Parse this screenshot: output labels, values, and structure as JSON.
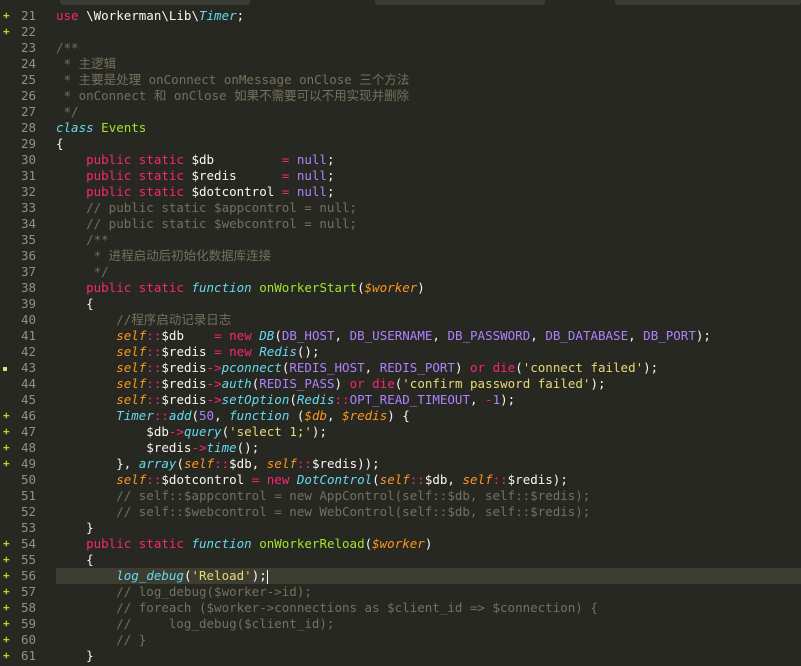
{
  "colors": {
    "background": "#272822",
    "gutter_text": "#90908a",
    "current_line": "#3e3d32",
    "diff_added": "#a6e22e",
    "diff_modified": "#e6db74"
  },
  "editor": {
    "current_line": 56,
    "lines": [
      {
        "n": "21",
        "mark": "add",
        "tokens": [
          [
            "kw",
            "use"
          ],
          [
            "pl",
            " \\Workerman\\Lib\\"
          ],
          [
            "cls",
            "Timer"
          ],
          [
            "pl",
            ";"
          ]
        ]
      },
      {
        "n": "22",
        "mark": "add",
        "tokens": []
      },
      {
        "n": "23",
        "mark": "",
        "tokens": [
          [
            "cm",
            "/**"
          ]
        ]
      },
      {
        "n": "24",
        "mark": "",
        "tokens": [
          [
            "cm",
            " * 主逻辑"
          ]
        ]
      },
      {
        "n": "25",
        "mark": "",
        "tokens": [
          [
            "cm",
            " * 主要是处理 onConnect onMessage onClose 三个方法"
          ]
        ]
      },
      {
        "n": "26",
        "mark": "",
        "tokens": [
          [
            "cm",
            " * onConnect 和 onClose 如果不需要可以不用实现并删除"
          ]
        ]
      },
      {
        "n": "27",
        "mark": "",
        "tokens": [
          [
            "cm",
            " */"
          ]
        ]
      },
      {
        "n": "28",
        "mark": "",
        "tokens": [
          [
            "st",
            "class"
          ],
          [
            "pl",
            " "
          ],
          [
            "fn",
            "Events"
          ]
        ]
      },
      {
        "n": "29",
        "mark": "",
        "tokens": [
          [
            "pl",
            "{"
          ]
        ]
      },
      {
        "n": "30",
        "mark": "",
        "tokens": [
          [
            "pl",
            "    "
          ],
          [
            "kw",
            "public"
          ],
          [
            "pl",
            " "
          ],
          [
            "kw",
            "static"
          ],
          [
            "pl",
            " $db         "
          ],
          [
            "kw",
            "="
          ],
          [
            "pl",
            " "
          ],
          [
            "ct",
            "null"
          ],
          [
            "pl",
            ";"
          ]
        ]
      },
      {
        "n": "31",
        "mark": "",
        "tokens": [
          [
            "pl",
            "    "
          ],
          [
            "kw",
            "public"
          ],
          [
            "pl",
            " "
          ],
          [
            "kw",
            "static"
          ],
          [
            "pl",
            " $redis      "
          ],
          [
            "kw",
            "="
          ],
          [
            "pl",
            " "
          ],
          [
            "ct",
            "null"
          ],
          [
            "pl",
            ";"
          ]
        ]
      },
      {
        "n": "32",
        "mark": "",
        "tokens": [
          [
            "pl",
            "    "
          ],
          [
            "kw",
            "public"
          ],
          [
            "pl",
            " "
          ],
          [
            "kw",
            "static"
          ],
          [
            "pl",
            " $dotcontrol "
          ],
          [
            "kw",
            "="
          ],
          [
            "pl",
            " "
          ],
          [
            "ct",
            "null"
          ],
          [
            "pl",
            ";"
          ]
        ]
      },
      {
        "n": "33",
        "mark": "",
        "tokens": [
          [
            "cm",
            "    // public static $appcontrol = null;"
          ]
        ]
      },
      {
        "n": "34",
        "mark": "",
        "tokens": [
          [
            "cm",
            "    // public static $webcontrol = null;"
          ]
        ]
      },
      {
        "n": "35",
        "mark": "",
        "tokens": [
          [
            "cm",
            "    /**"
          ]
        ]
      },
      {
        "n": "36",
        "mark": "",
        "tokens": [
          [
            "cm",
            "     * 进程启动后初始化数据库连接"
          ]
        ]
      },
      {
        "n": "37",
        "mark": "",
        "tokens": [
          [
            "cm",
            "     */"
          ]
        ]
      },
      {
        "n": "38",
        "mark": "",
        "tokens": [
          [
            "pl",
            "    "
          ],
          [
            "kw",
            "public"
          ],
          [
            "pl",
            " "
          ],
          [
            "kw",
            "static"
          ],
          [
            "pl",
            " "
          ],
          [
            "st",
            "function"
          ],
          [
            "pl",
            " "
          ],
          [
            "fn",
            "onWorkerStart"
          ],
          [
            "pl",
            "("
          ],
          [
            "var",
            "$worker"
          ],
          [
            "pl",
            ")"
          ]
        ]
      },
      {
        "n": "39",
        "mark": "",
        "tokens": [
          [
            "pl",
            "    {"
          ]
        ]
      },
      {
        "n": "40",
        "mark": "",
        "tokens": [
          [
            "cm",
            "        //程序启动记录日志"
          ]
        ]
      },
      {
        "n": "41",
        "mark": "",
        "tokens": [
          [
            "pl",
            "        "
          ],
          [
            "slf",
            "self"
          ],
          [
            "kw",
            "::"
          ],
          [
            "pl",
            "$db    "
          ],
          [
            "kw",
            "="
          ],
          [
            "pl",
            " "
          ],
          [
            "kw",
            "new"
          ],
          [
            "pl",
            " "
          ],
          [
            "cls",
            "DB"
          ],
          [
            "pl",
            "("
          ],
          [
            "ct",
            "DB_HOST"
          ],
          [
            "pl",
            ", "
          ],
          [
            "ct",
            "DB_USERNAME"
          ],
          [
            "pl",
            ", "
          ],
          [
            "ct",
            "DB_PASSWORD"
          ],
          [
            "pl",
            ", "
          ],
          [
            "ct",
            "DB_DATABASE"
          ],
          [
            "pl",
            ", "
          ],
          [
            "ct",
            "DB_PORT"
          ],
          [
            "pl",
            ");"
          ]
        ]
      },
      {
        "n": "42",
        "mark": "",
        "tokens": [
          [
            "pl",
            "        "
          ],
          [
            "slf",
            "self"
          ],
          [
            "kw",
            "::"
          ],
          [
            "pl",
            "$redis "
          ],
          [
            "kw",
            "="
          ],
          [
            "pl",
            " "
          ],
          [
            "kw",
            "new"
          ],
          [
            "pl",
            " "
          ],
          [
            "cls",
            "Redis"
          ],
          [
            "pl",
            "();"
          ]
        ]
      },
      {
        "n": "43",
        "mark": "mod",
        "tokens": [
          [
            "pl",
            "        "
          ],
          [
            "slf",
            "self"
          ],
          [
            "kw",
            "::"
          ],
          [
            "pl",
            "$redis"
          ],
          [
            "kw",
            "->"
          ],
          [
            "ty",
            "pconnect"
          ],
          [
            "pl",
            "("
          ],
          [
            "ct",
            "REDIS_HOST"
          ],
          [
            "pl",
            ", "
          ],
          [
            "ct",
            "REDIS_PORT"
          ],
          [
            "pl",
            ") "
          ],
          [
            "kw",
            "or"
          ],
          [
            "pl",
            " "
          ],
          [
            "kw",
            "die"
          ],
          [
            "pl",
            "("
          ],
          [
            "str",
            "'connect failed'"
          ],
          [
            "pl",
            ");"
          ]
        ]
      },
      {
        "n": "44",
        "mark": "",
        "tokens": [
          [
            "pl",
            "        "
          ],
          [
            "slf",
            "self"
          ],
          [
            "kw",
            "::"
          ],
          [
            "pl",
            "$redis"
          ],
          [
            "kw",
            "->"
          ],
          [
            "ty",
            "auth"
          ],
          [
            "pl",
            "("
          ],
          [
            "ct",
            "REDIS_PASS"
          ],
          [
            "pl",
            ") "
          ],
          [
            "kw",
            "or"
          ],
          [
            "pl",
            " "
          ],
          [
            "kw",
            "die"
          ],
          [
            "pl",
            "("
          ],
          [
            "str",
            "'confirm password failed'"
          ],
          [
            "pl",
            ");"
          ]
        ]
      },
      {
        "n": "45",
        "mark": "",
        "tokens": [
          [
            "pl",
            "        "
          ],
          [
            "slf",
            "self"
          ],
          [
            "kw",
            "::"
          ],
          [
            "pl",
            "$redis"
          ],
          [
            "kw",
            "->"
          ],
          [
            "ty",
            "setOption"
          ],
          [
            "pl",
            "("
          ],
          [
            "cls",
            "Redis"
          ],
          [
            "kw",
            "::"
          ],
          [
            "ct",
            "OPT_READ_TIMEOUT"
          ],
          [
            "pl",
            ", "
          ],
          [
            "kw",
            "-"
          ],
          [
            "num",
            "1"
          ],
          [
            "pl",
            ");"
          ]
        ]
      },
      {
        "n": "46",
        "mark": "add",
        "tokens": [
          [
            "pl",
            "        "
          ],
          [
            "cls",
            "Timer"
          ],
          [
            "kw",
            "::"
          ],
          [
            "ty",
            "add"
          ],
          [
            "pl",
            "("
          ],
          [
            "num",
            "50"
          ],
          [
            "pl",
            ", "
          ],
          [
            "st",
            "function"
          ],
          [
            "pl",
            " ("
          ],
          [
            "var",
            "$db"
          ],
          [
            "pl",
            ", "
          ],
          [
            "var",
            "$redis"
          ],
          [
            "pl",
            ") {"
          ]
        ]
      },
      {
        "n": "47",
        "mark": "add",
        "tokens": [
          [
            "pl",
            "            $db"
          ],
          [
            "kw",
            "->"
          ],
          [
            "ty",
            "query"
          ],
          [
            "pl",
            "("
          ],
          [
            "str",
            "'select 1;'"
          ],
          [
            "pl",
            ");"
          ]
        ]
      },
      {
        "n": "48",
        "mark": "add",
        "tokens": [
          [
            "pl",
            "            $redis"
          ],
          [
            "kw",
            "->"
          ],
          [
            "ty",
            "time"
          ],
          [
            "pl",
            "();"
          ]
        ]
      },
      {
        "n": "49",
        "mark": "add",
        "tokens": [
          [
            "pl",
            "        }, "
          ],
          [
            "ty",
            "array"
          ],
          [
            "pl",
            "("
          ],
          [
            "slf",
            "self"
          ],
          [
            "kw",
            "::"
          ],
          [
            "pl",
            "$db, "
          ],
          [
            "slf",
            "self"
          ],
          [
            "kw",
            "::"
          ],
          [
            "pl",
            "$redis));"
          ]
        ]
      },
      {
        "n": "50",
        "mark": "",
        "tokens": [
          [
            "pl",
            "        "
          ],
          [
            "slf",
            "self"
          ],
          [
            "kw",
            "::"
          ],
          [
            "pl",
            "$dotcontrol "
          ],
          [
            "kw",
            "="
          ],
          [
            "pl",
            " "
          ],
          [
            "kw",
            "new"
          ],
          [
            "pl",
            " "
          ],
          [
            "cls",
            "DotControl"
          ],
          [
            "pl",
            "("
          ],
          [
            "slf",
            "self"
          ],
          [
            "kw",
            "::"
          ],
          [
            "pl",
            "$db, "
          ],
          [
            "slf",
            "self"
          ],
          [
            "kw",
            "::"
          ],
          [
            "pl",
            "$redis);"
          ]
        ]
      },
      {
        "n": "51",
        "mark": "",
        "tokens": [
          [
            "cm",
            "        // self::$appcontrol = new AppControl(self::$db, self::$redis);"
          ]
        ]
      },
      {
        "n": "52",
        "mark": "",
        "tokens": [
          [
            "cm",
            "        // self::$webcontrol = new WebControl(self::$db, self::$redis);"
          ]
        ]
      },
      {
        "n": "53",
        "mark": "",
        "tokens": [
          [
            "pl",
            "    }"
          ]
        ]
      },
      {
        "n": "54",
        "mark": "add",
        "tokens": [
          [
            "pl",
            "    "
          ],
          [
            "kw",
            "public"
          ],
          [
            "pl",
            " "
          ],
          [
            "kw",
            "static"
          ],
          [
            "pl",
            " "
          ],
          [
            "st",
            "function"
          ],
          [
            "pl",
            " "
          ],
          [
            "fn",
            "onWorkerReload"
          ],
          [
            "pl",
            "("
          ],
          [
            "var",
            "$worker"
          ],
          [
            "pl",
            ")"
          ]
        ]
      },
      {
        "n": "55",
        "mark": "add",
        "tokens": [
          [
            "pl",
            "    {"
          ]
        ]
      },
      {
        "n": "56",
        "mark": "add",
        "tokens": [
          [
            "pl",
            "        "
          ],
          [
            "ty",
            "log_debug"
          ],
          [
            "pl",
            "("
          ],
          [
            "str",
            "'Reload'"
          ],
          [
            "pl",
            ");"
          ]
        ]
      },
      {
        "n": "57",
        "mark": "add",
        "tokens": [
          [
            "cm",
            "        // log_debug($worker->id);"
          ]
        ]
      },
      {
        "n": "58",
        "mark": "add",
        "tokens": [
          [
            "cm",
            "        // foreach ($worker->connections as $client_id => $connection) {"
          ]
        ]
      },
      {
        "n": "59",
        "mark": "add",
        "tokens": [
          [
            "cm",
            "        //     log_debug($client_id);"
          ]
        ]
      },
      {
        "n": "60",
        "mark": "add",
        "tokens": [
          [
            "cm",
            "        // }"
          ]
        ]
      },
      {
        "n": "61",
        "mark": "add",
        "tokens": [
          [
            "pl",
            "    }"
          ]
        ]
      }
    ]
  }
}
